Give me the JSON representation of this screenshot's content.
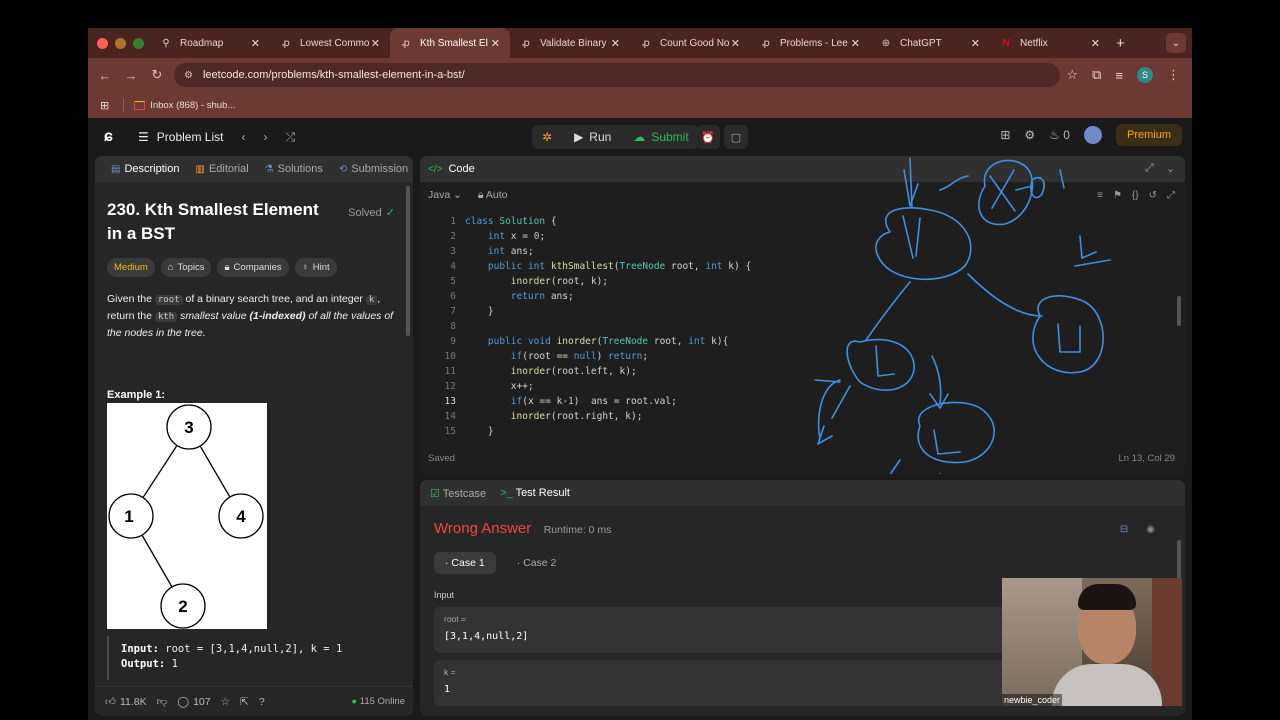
{
  "browser": {
    "tabs": [
      {
        "label": "Roadmap",
        "icon": "pin-icon",
        "active": false
      },
      {
        "label": "Lowest Commo",
        "icon": "tab-icon",
        "active": false
      },
      {
        "label": "Kth Smallest El",
        "icon": "tab-icon",
        "active": true
      },
      {
        "label": "Validate Binary",
        "icon": "tab-icon",
        "active": false
      },
      {
        "label": "Count Good No",
        "icon": "tab-icon",
        "active": false
      },
      {
        "label": "Problems - Lee",
        "icon": "tab-icon",
        "active": false
      },
      {
        "label": "ChatGPT",
        "icon": "chatgpt-icon",
        "active": false
      },
      {
        "label": "Netflix",
        "icon": "netflix-icon",
        "active": false
      }
    ],
    "url": "leetcode.com/problems/kth-smallest-element-in-a-bst/",
    "profile_initial": "S",
    "bookmark": "Inbox (868) - shub..."
  },
  "lc_nav": {
    "problem_list": "Problem List",
    "run": "Run",
    "submit": "Submit",
    "streak": "0",
    "premium": "Premium"
  },
  "left": {
    "tabs": [
      "Description",
      "Editorial",
      "Solutions",
      "Submission"
    ],
    "title": "230. Kth Smallest Element in a BST",
    "status": "Solved",
    "tags": [
      "Medium",
      "Topics",
      "Companies",
      "Hint"
    ],
    "desc": {
      "p1": "Given the",
      "code_root": "root",
      "p2": "of a binary search tree, and an integer",
      "code_k": "k",
      "p3": ", return the",
      "code_kth": "kth",
      "p4": "smallest value",
      "p5": "(1-indexed)",
      "p6": "of all the values of the nodes in the tree."
    },
    "example_title": "Example 1:",
    "tree": {
      "nodes": [
        "3",
        "1",
        "4",
        "2"
      ]
    },
    "io": {
      "input_label": "Input:",
      "input_value": "root = [3,1,4,null,2], k = 1",
      "output_label": "Output:",
      "output_value": "1"
    },
    "footer": {
      "likes": "11.8K",
      "comments": "107",
      "online": "115 Online"
    }
  },
  "code": {
    "header": "Code",
    "language": "Java",
    "mode": "Auto",
    "status": "Saved",
    "cursor": "Ln 13, Col 29",
    "current_line": 13,
    "lines": [
      "class Solution {",
      "    int x = 0;",
      "    int ans;",
      "    public int kthSmallest(TreeNode root, int k) {",
      "        inorder(root, k);",
      "        return ans;",
      "    }",
      "",
      "    public void inorder(TreeNode root, int k){",
      "        if(root == null) return;",
      "        inorder(root.left, k);",
      "        x++;",
      "        if(x == k-1)  ans = root.val;",
      "        inorder(root.right, k);",
      "    }"
    ],
    "annotation": {
      "color": "#3d8fe0"
    }
  },
  "result": {
    "tabs": [
      "Testcase",
      "Test Result"
    ],
    "verdict": "Wrong Answer",
    "runtime": "Runtime: 0 ms",
    "cases": [
      "Case 1",
      "Case 2"
    ],
    "input_label": "Input",
    "params": [
      {
        "name": "root =",
        "value": "[3,1,4,null,2]"
      },
      {
        "name": "k =",
        "value": "1"
      }
    ]
  },
  "webcam": {
    "name": "newbie_coder"
  }
}
